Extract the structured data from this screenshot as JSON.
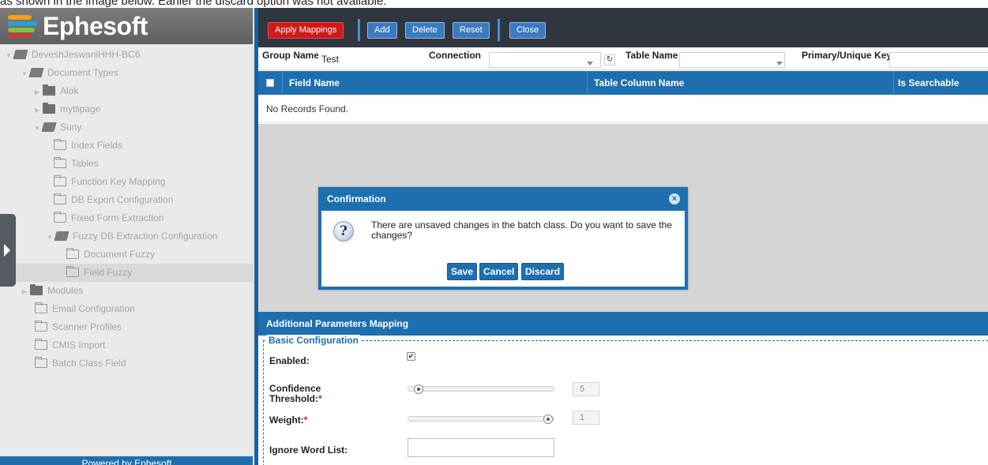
{
  "caption": "as shown in the image below. Earlier the discard option was not available.",
  "brand": {
    "name": "Ephesoft",
    "footer": "Powered by Ephesoft",
    "accent": "#1e6fb0",
    "danger": "#d01a1a"
  },
  "tree": {
    "root": "DeveshJeswaniHHH-BC6",
    "document_types": "Document Types",
    "alok": "Alok",
    "mytlipage": "mytlipage",
    "suny": "Suny",
    "index_fields": "Index Fields",
    "tables": "Tables",
    "function_key_mapping": "Function Key Mapping",
    "db_export_configuration": "DB Export Configuration",
    "fixed_form_extraction": "Fixed Form Extraction",
    "fuzzy_db_extraction_configuration": "Fuzzy DB Extraction Configuration",
    "document_fuzzy": "Document Fuzzy",
    "field_fuzzy": "Field Fuzzy",
    "modules": "Modules",
    "email_configuration": "Email Configuration",
    "scanner_profiles": "Scanner Profiles",
    "cmis_import": "CMIS Import",
    "batch_class_field": "Batch Class Field"
  },
  "toolbar": {
    "apply_mappings": "Apply Mappings",
    "add": "Add",
    "delete": "Delete",
    "reset": "Reset",
    "close": "Close"
  },
  "filters": {
    "group_name_label": "Group Name",
    "group_name_value": "Test",
    "connection_label": "Connection",
    "connection_value": "",
    "table_name_label": "Table Name",
    "table_name_value": "",
    "primary_key_label": "Primary/Unique Key",
    "primary_key_value": ""
  },
  "grid": {
    "columns": [
      "Field Name",
      "Table Column Name",
      "Is Searchable"
    ],
    "empty_text": "No Records Found."
  },
  "params": {
    "section_title": "Additional Parameters Mapping",
    "legend": "Basic Configuration",
    "enabled_label": "Enabled:",
    "enabled_checked": true,
    "confidence_label": "Confidence Threshold:",
    "confidence_value": "5",
    "weight_label": "Weight:",
    "weight_value": "1",
    "ignore_label": "Ignore Word List:",
    "required_mark": "*"
  },
  "dialog": {
    "title": "Confirmation",
    "message": "There are unsaved changes in the batch class. Do you want to save the changes?",
    "save": "Save",
    "cancel": "Cancel",
    "discard": "Discard"
  }
}
